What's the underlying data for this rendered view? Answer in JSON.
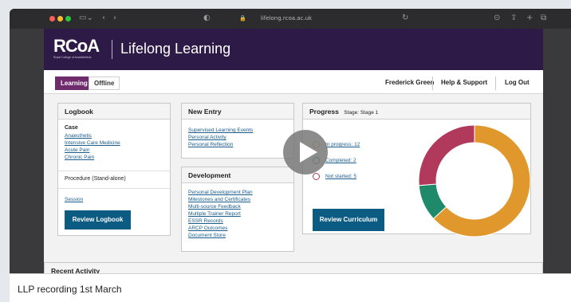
{
  "browser": {
    "url": "lifelong.rcoa.ac.uk"
  },
  "header": {
    "logo_text": "RCoA",
    "logo_sub": "Royal College of Anaesthetists",
    "title": "Lifelong Learning"
  },
  "nav": {
    "tabs": [
      {
        "label": "Learning",
        "active": true
      },
      {
        "label": "Offline",
        "active": false
      }
    ],
    "user": "Frederick Green",
    "help": "Help & Support",
    "logout": "Log Out"
  },
  "logbook": {
    "title": "Logbook",
    "case_label": "Case",
    "case_links": [
      "Anaesthetic",
      "Intensive Care Medicine",
      "Acute Pain",
      "Chronic Pain"
    ],
    "procedure": "Procedure (Stand-alone)",
    "session": "Session",
    "button": "Review Logbook"
  },
  "new_entry": {
    "title": "New Entry",
    "links": [
      "Supervised Learning Events",
      "Personal Activity",
      "Personal Reflection"
    ]
  },
  "development": {
    "title": "Development",
    "links": [
      "Personal Development Plan",
      "Milestones and Certificates",
      "Multi-source Feedback",
      "Multiple Trainer Report",
      "ESSR Records",
      "ARCP Outcomes",
      "Document Store"
    ]
  },
  "progress": {
    "title": "Progress",
    "stage": "Stage: Stage 1",
    "legend": [
      {
        "label": "In progress: 12",
        "color": "#e0982c"
      },
      {
        "label": "Completed: 2",
        "color": "#1e8a6a"
      },
      {
        "label": "Not started: 5",
        "color": "#b13a5c"
      }
    ],
    "button": "Review Curriculum"
  },
  "chart_data": {
    "type": "pie",
    "categories": [
      "In progress",
      "Completed",
      "Not started"
    ],
    "values": [
      12,
      2,
      5
    ],
    "colors": [
      "#e0982c",
      "#1e8a6a",
      "#b13a5c"
    ],
    "donut": true
  },
  "recent": {
    "title": "Recent Activity"
  },
  "caption": "LLP recording 1st March"
}
